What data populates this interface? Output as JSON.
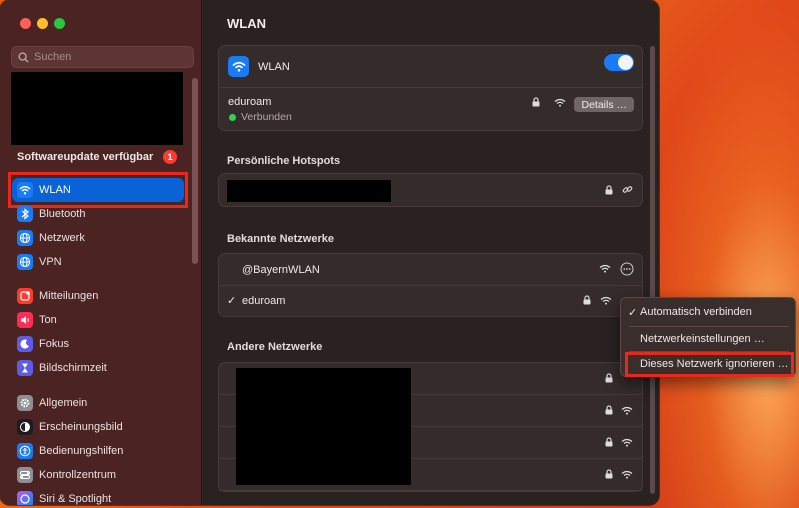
{
  "window": {
    "title": "WLAN"
  },
  "sidebar": {
    "search_placeholder": "Suchen",
    "update_label": "Softwareupdate verfügbar",
    "update_badge": "1",
    "items": [
      {
        "label": "WLAN",
        "icon": "wifi-icon",
        "color": "#1a7cf5"
      },
      {
        "label": "Bluetooth",
        "icon": "bluetooth-icon",
        "color": "#1a7cf5"
      },
      {
        "label": "Netzwerk",
        "icon": "globe-icon",
        "color": "#1a7cf5"
      },
      {
        "label": "VPN",
        "icon": "globe-icon",
        "color": "#1a7cf5"
      },
      {
        "label": "Mitteilungen",
        "icon": "bell-icon",
        "color": "#ff3b30"
      },
      {
        "label": "Ton",
        "icon": "speaker-icon",
        "color": "#ff2d55"
      },
      {
        "label": "Fokus",
        "icon": "moon-icon",
        "color": "#5e5ce6"
      },
      {
        "label": "Bildschirmzeit",
        "icon": "hourglass-icon",
        "color": "#5e5ce6"
      },
      {
        "label": "Allgemein",
        "icon": "gear-icon",
        "color": "#8e8e93"
      },
      {
        "label": "Erscheinungsbild",
        "icon": "appearance-icon",
        "color": "#1c1c1e"
      },
      {
        "label": "Bedienungshilfen",
        "icon": "accessibility-icon",
        "color": "#1a7cf5"
      },
      {
        "label": "Kontrollzentrum",
        "icon": "control-center-icon",
        "color": "#8e8e93"
      },
      {
        "label": "Siri & Spotlight",
        "icon": "siri-icon",
        "color": "#bf5af2"
      }
    ]
  },
  "main": {
    "title": "WLAN",
    "wlan_card": {
      "label": "WLAN",
      "toggle_on": true,
      "network_name": "eduroam",
      "status": "Verbunden",
      "status_color": "#30d158",
      "details_label": "Details …"
    },
    "hotspots_heading": "Persönliche Hotspots",
    "known_heading": "Bekannte Netzwerke",
    "known_networks": [
      {
        "name": "@BayernWLAN",
        "checked": false
      },
      {
        "name": "eduroam",
        "checked": true
      }
    ],
    "other_heading": "Andere Netzwerke"
  },
  "context_menu": {
    "items": [
      {
        "label": "Automatisch verbinden",
        "checked": true
      },
      {
        "label": "Netzwerkeinstellungen …",
        "checked": false
      },
      {
        "label": "Dieses Netzwerk ignorieren …",
        "checked": false
      }
    ]
  },
  "accent_color": "#1a7cf5",
  "highlight_color": "#e8281a"
}
